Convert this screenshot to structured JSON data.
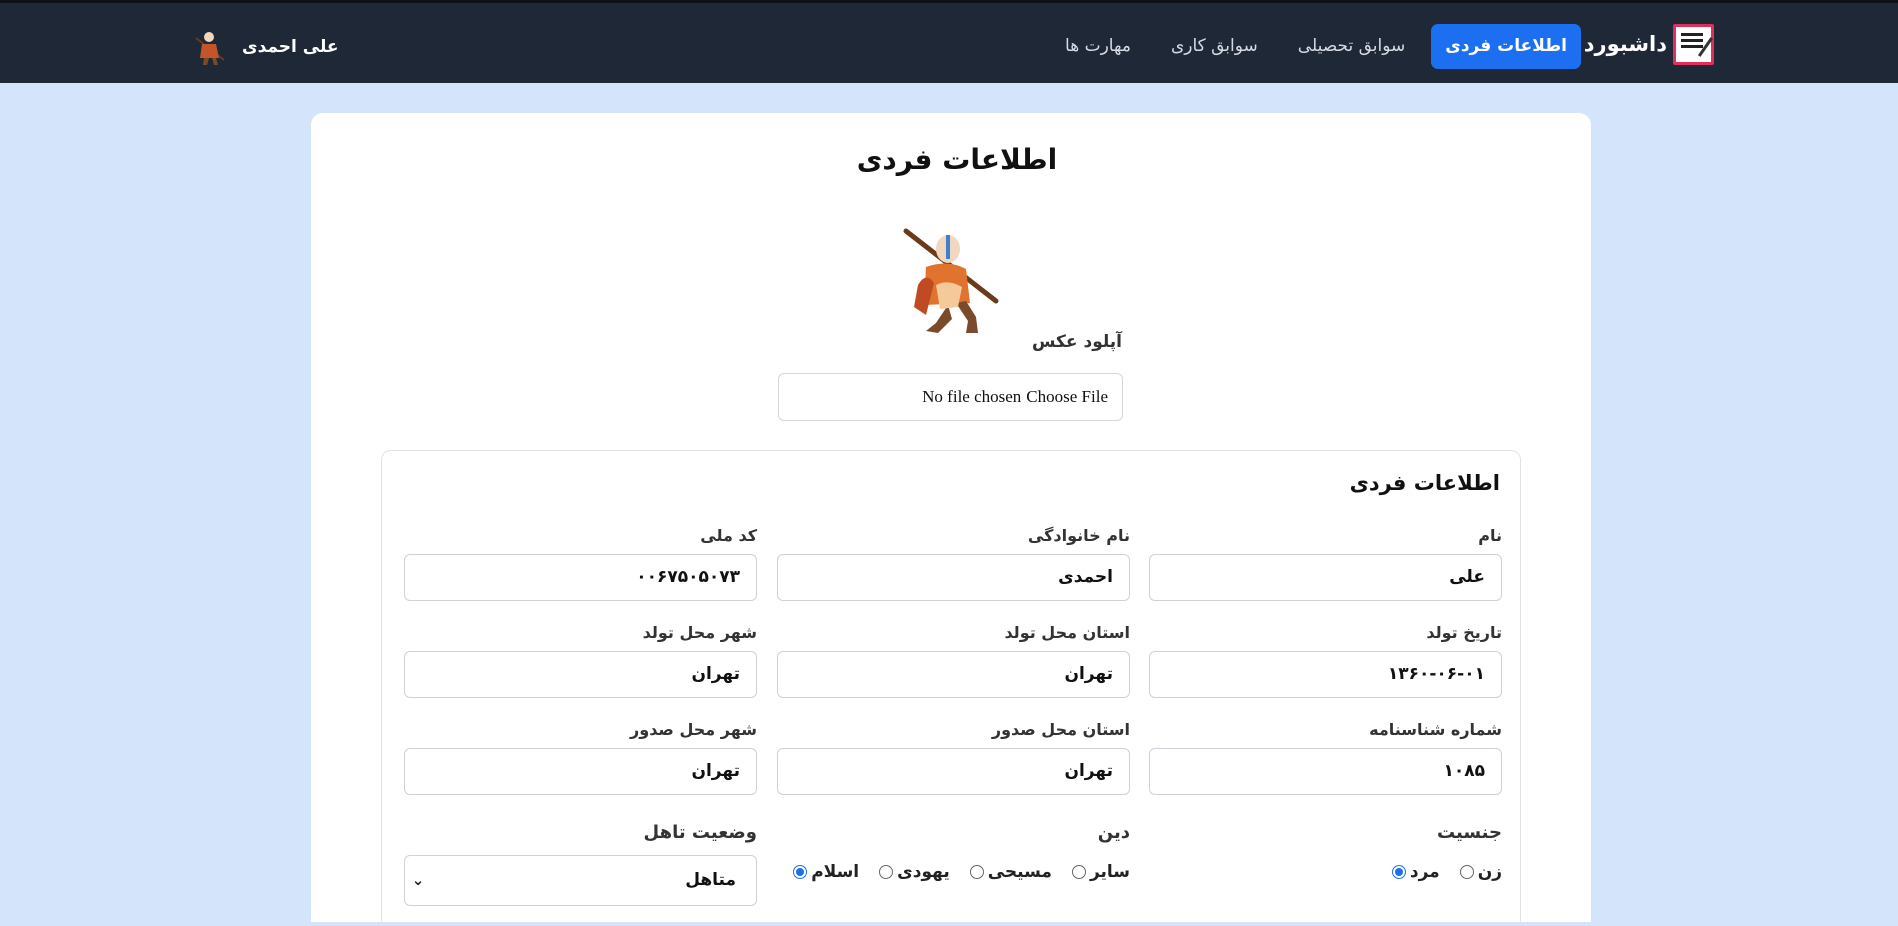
{
  "navbar": {
    "brand_text": "داشبورد",
    "brand_logo_label": "RESUME",
    "links": [
      {
        "label": "اطلاعات فردی",
        "active": true
      },
      {
        "label": "سوابق تحصیلی",
        "active": false
      },
      {
        "label": "سوابق کاری",
        "active": false
      },
      {
        "label": "مهارت ها",
        "active": false
      }
    ],
    "user_name": "علی احمدی"
  },
  "page": {
    "title": "اطلاعات فردی",
    "upload_label": "آپلود عکس",
    "file_button": "Choose File",
    "file_status": "No file chosen"
  },
  "section": {
    "title": "اطلاعات فردی",
    "fields": {
      "first_name": {
        "label": "نام",
        "value": "علی"
      },
      "last_name": {
        "label": "نام خانوادگی",
        "value": "احمدی"
      },
      "national_code": {
        "label": "کد ملی",
        "value": "۰۰۶۷۵۰۵۰۷۳"
      },
      "birth_date": {
        "label": "تاریخ تولد",
        "value": "۱۳۶۰-۰۶-۰۱"
      },
      "birth_province": {
        "label": "استان محل تولد",
        "value": "تهران"
      },
      "birth_city": {
        "label": "شهر محل تولد",
        "value": "تهران"
      },
      "id_number": {
        "label": "شماره شناسنامه",
        "value": "۱۰۸۵"
      },
      "issue_province": {
        "label": "استان محل صدور",
        "value": "تهران"
      },
      "issue_city": {
        "label": "شهر محل صدور",
        "value": "تهران"
      }
    },
    "gender": {
      "label": "جنسیت",
      "options": [
        {
          "label": "مرد",
          "checked": true
        },
        {
          "label": "زن",
          "checked": false
        }
      ]
    },
    "religion": {
      "label": "دین",
      "options": [
        {
          "label": "اسلام",
          "checked": true
        },
        {
          "label": "یهودی",
          "checked": false
        },
        {
          "label": "مسیحی",
          "checked": false
        },
        {
          "label": "سایر",
          "checked": false
        }
      ]
    },
    "marital": {
      "label": "وضعیت تاهل",
      "selected": "متاهل"
    }
  },
  "colors": {
    "navbar_bg": "#1f2837",
    "accent": "#1d6ff2",
    "page_bg": "#d4e5fb"
  },
  "icons": {
    "avatar": "aang-character-avatar",
    "brand": "resume-logo-icon",
    "select_chevron": "chevron-down-icon"
  }
}
